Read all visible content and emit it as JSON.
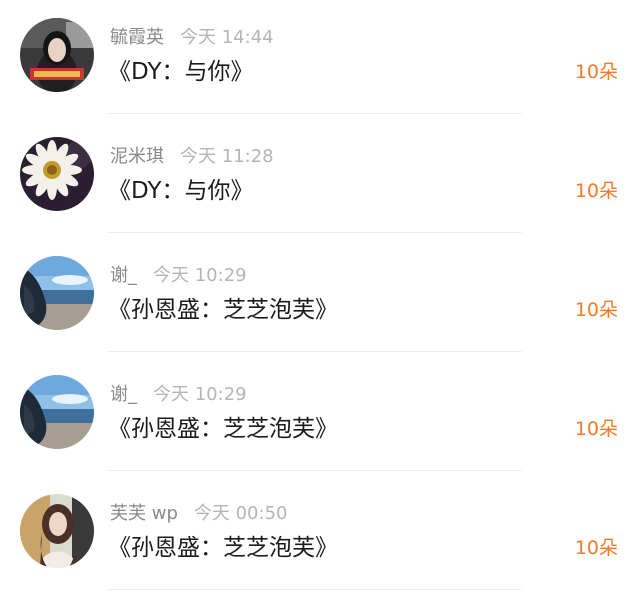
{
  "gift_list": {
    "items": [
      {
        "name": "毓霞英",
        "time": "今天 14:44",
        "song": "《DY：与你》",
        "count": "10朵",
        "avatar": "portrait-woman-car"
      },
      {
        "name": "泥米琪",
        "time": "今天 11:28",
        "song": "《DY：与你》",
        "count": "10朵",
        "avatar": "sunflower"
      },
      {
        "name": "谢_",
        "time": "今天 10:29",
        "song": "《孙恩盛：芝芝泡芙》",
        "count": "10朵",
        "avatar": "beach-sky"
      },
      {
        "name": "谢_",
        "time": "今天 10:29",
        "song": "《孙恩盛：芝芝泡芙》",
        "count": "10朵",
        "avatar": "beach-sky"
      },
      {
        "name": "芙芙 wp",
        "time": "今天 00:50",
        "song": "《孙恩盛：芝芝泡芙》",
        "count": "10朵",
        "avatar": "portrait-woman"
      }
    ]
  },
  "colors": {
    "count_accent": "#f47a2a",
    "name_gray": "#8a8a8a",
    "time_gray": "#b5b5b5",
    "song_text": "#1c1c1c"
  }
}
